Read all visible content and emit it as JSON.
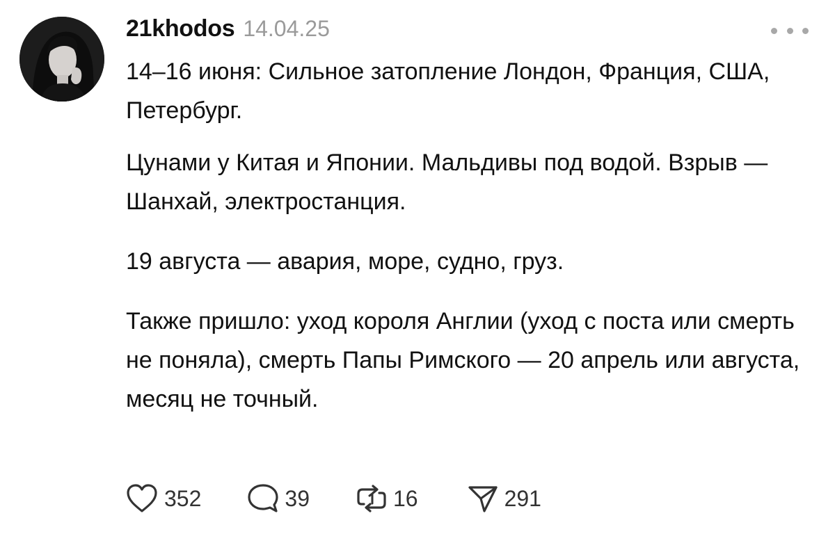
{
  "post": {
    "username": "21khodos",
    "timestamp": "14.04.25",
    "paragraphs": [
      "14–16 июня: Сильное затопление Лондон, Франция, США, Петербург.",
      "Цунами у Китая и Японии. Мальдивы под водой. Взрыв — Шанхай, электростанция.",
      "19 августа — авария, море, судно, груз.",
      "Также пришло: уход короля Англии (уход с поста или смерть не поняла), смерть Папы Римского — 20 апрель или августа, месяц не точный."
    ]
  },
  "actions": {
    "likes": "352",
    "replies": "39",
    "reposts": "16",
    "shares": "291"
  },
  "icons": {
    "more": "more-horizontal-icon",
    "like": "heart-icon",
    "reply": "speech-bubble-icon",
    "repost": "repost-arrows-icon",
    "share": "paper-plane-icon"
  }
}
